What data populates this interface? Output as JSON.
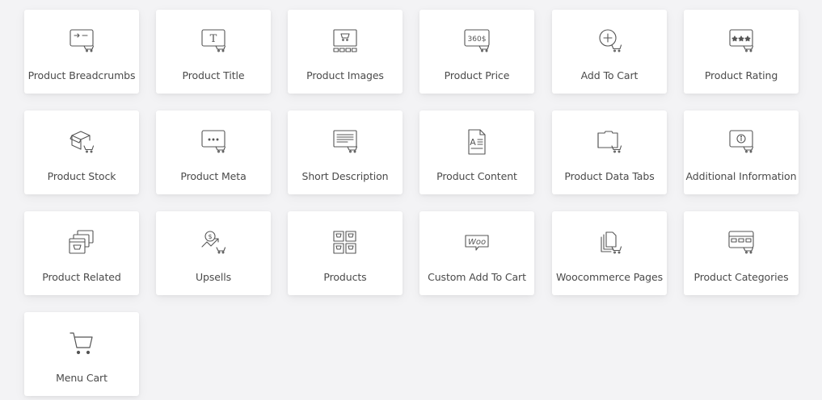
{
  "widgets": [
    {
      "label": "Product Breadcrumbs",
      "icon": "product-breadcrumbs-icon"
    },
    {
      "label": "Product Title",
      "icon": "product-title-icon"
    },
    {
      "label": "Product Images",
      "icon": "product-images-icon"
    },
    {
      "label": "Product Price",
      "icon": "product-price-icon"
    },
    {
      "label": "Add To Cart",
      "icon": "add-to-cart-icon"
    },
    {
      "label": "Product Rating",
      "icon": "product-rating-icon"
    },
    {
      "label": "Product Stock",
      "icon": "product-stock-icon"
    },
    {
      "label": "Product Meta",
      "icon": "product-meta-icon"
    },
    {
      "label": "Short Description",
      "icon": "short-description-icon"
    },
    {
      "label": "Product Content",
      "icon": "product-content-icon"
    },
    {
      "label": "Product Data Tabs",
      "icon": "product-data-tabs-icon"
    },
    {
      "label": "Additional Information",
      "icon": "additional-information-icon"
    },
    {
      "label": "Product Related",
      "icon": "product-related-icon"
    },
    {
      "label": "Upsells",
      "icon": "upsells-icon"
    },
    {
      "label": "Products",
      "icon": "products-icon"
    },
    {
      "label": "Custom Add To Cart",
      "icon": "custom-add-to-cart-icon"
    },
    {
      "label": "Woocommerce Pages",
      "icon": "woocommerce-pages-icon"
    },
    {
      "label": "Product Categories",
      "icon": "product-categories-icon"
    },
    {
      "label": "Menu Cart",
      "icon": "menu-cart-icon"
    }
  ],
  "icon_glyphs": {
    "price_text": "360$",
    "title_letter": "T",
    "content_letter": "A",
    "woo_text": "Woo",
    "upsell_symbol": "$"
  },
  "colors": {
    "icon_stroke": "#555555",
    "label_text": "#4a4a4a",
    "card_bg": "#ffffff",
    "page_bg": "#f3f3f5"
  }
}
